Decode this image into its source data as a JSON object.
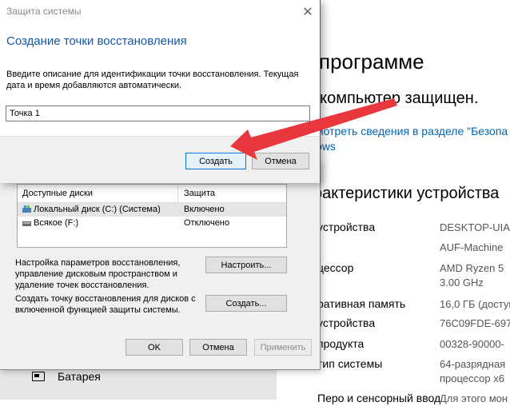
{
  "settings_bg": {
    "heading": "программе",
    "protected": "ı компьютер защищен.",
    "link_line1": "мотреть сведения в разделе \"Безопа",
    "link_line2": "ows",
    "section": "рактеристики устройства",
    "specs": [
      {
        "label": "устройства",
        "value": "DESKTOP-UIAS"
      },
      {
        "label": "",
        "value": "AUF-Machine"
      },
      {
        "label": "цессор",
        "value": "AMD Ryzen 5"
      },
      {
        "label": "",
        "value": "3.00 GHz"
      },
      {
        "label": "ративная память",
        "value": "16,0 ГБ (доступ"
      },
      {
        "label": "устройства",
        "value": "76C09FDE-697"
      },
      {
        "label": "продукта",
        "value": "00328-90000-"
      },
      {
        "label": "тип системы",
        "value": "64-разрядная"
      },
      {
        "label": "",
        "value": "процессор x6"
      },
      {
        "label": "Перо и сенсорный ввод",
        "value": "Для этого мон"
      }
    ],
    "left_item": "Батарея"
  },
  "system_properties": {
    "drives_header": {
      "col1": "Доступные диски",
      "col2": "Защита"
    },
    "drives": [
      {
        "name": "Локальный диск (C:) (Система)",
        "state": "Включено"
      },
      {
        "name": "Всякое (F:)",
        "state": "Отключено"
      }
    ],
    "configure_text": "Настройка параметров восстановления, управление дисковым пространством и удаление точек восстановления.",
    "configure_button": "Настроить...",
    "create_text": "Создать точку восстановления для дисков с включенной функцией защиты системы.",
    "create_button": "Создать...",
    "ok_button": "OK",
    "cancel_button": "Отмена",
    "apply_button": "Применить"
  },
  "restore_dialog": {
    "title": "Защита системы",
    "close_glyph": "✕",
    "heading": "Создание точки восстановления",
    "description": "Введите описание для идентификации точки восстановления. Текущая дата и время добавляются автоматически.",
    "input_value": "Точка 1",
    "create_button": "Создать",
    "cancel_button": "Отмена"
  },
  "colors": {
    "accent_blue": "#1a56a5",
    "link_blue": "#0063b1",
    "arrow_red": "#e8383d"
  }
}
